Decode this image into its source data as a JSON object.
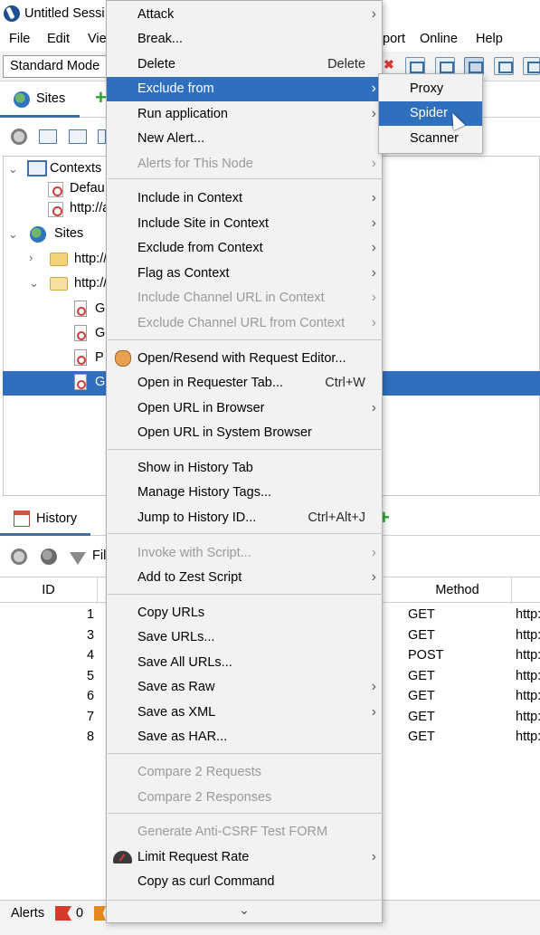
{
  "window": {
    "title": "Untitled Sessi"
  },
  "menubar": {
    "file": "File",
    "edit": "Edit",
    "view": "Vie",
    "report": "port",
    "online": "Online",
    "help": "Help"
  },
  "toolbar": {
    "mode": "Standard Mode"
  },
  "sites_panel": {
    "tab_label": "Sites",
    "tree": {
      "contexts": "Contexts",
      "default_context": "Defau",
      "context_url": "http://a",
      "sites": "Sites",
      "site1": "http://",
      "site2": "http://",
      "nodes": [
        "G",
        "G",
        "P",
        "G"
      ]
    }
  },
  "history_panel": {
    "tab_label": "History",
    "filter_label": "Fil",
    "columns": {
      "id": "ID",
      "method": "Method"
    },
    "rows": [
      {
        "id": "1",
        "method": "GET",
        "url": "http:"
      },
      {
        "id": "3",
        "method": "GET",
        "url": "http:"
      },
      {
        "id": "4",
        "method": "POST",
        "url": "http:"
      },
      {
        "id": "5",
        "method": "GET",
        "url": "http:"
      },
      {
        "id": "6",
        "method": "GET",
        "url": "http:"
      },
      {
        "id": "7",
        "method": "GET",
        "url": "http:"
      },
      {
        "id": "8",
        "method": "GET",
        "url": "http:"
      }
    ]
  },
  "statusbar": {
    "alerts_label": "Alerts",
    "alerts_count": "0"
  },
  "context_menu": {
    "items": [
      {
        "label": "Attack",
        "submenu": true
      },
      {
        "label": "Break..."
      },
      {
        "label": "Delete",
        "shortcut": "Delete"
      },
      {
        "label": "Exclude from",
        "submenu": true,
        "highlight": true
      },
      {
        "label": "Run application",
        "submenu": true
      },
      {
        "label": "New Alert..."
      },
      {
        "label": "Alerts for This Node",
        "submenu": true,
        "disabled": true
      },
      {
        "label": "Include in Context",
        "submenu": true
      },
      {
        "label": "Include Site in Context",
        "submenu": true
      },
      {
        "label": "Exclude from Context",
        "submenu": true
      },
      {
        "label": "Flag as Context",
        "submenu": true
      },
      {
        "label": "Include Channel URL in Context",
        "submenu": true,
        "disabled": true
      },
      {
        "label": "Exclude Channel URL from Context",
        "submenu": true,
        "disabled": true
      },
      {
        "label": "Open/Resend with Request Editor...",
        "icon": "hand-icon"
      },
      {
        "label": "Open in Requester Tab...",
        "shortcut": "Ctrl+W"
      },
      {
        "label": "Open URL in Browser",
        "submenu": true
      },
      {
        "label": "Open URL in System Browser"
      },
      {
        "label": "Show in History Tab"
      },
      {
        "label": "Manage History Tags..."
      },
      {
        "label": "Jump to History ID...",
        "shortcut": "Ctrl+Alt+J"
      },
      {
        "label": "Invoke with Script...",
        "submenu": true,
        "disabled": true
      },
      {
        "label": "Add to Zest Script",
        "submenu": true
      },
      {
        "label": "Copy URLs"
      },
      {
        "label": "Save URLs..."
      },
      {
        "label": "Save All URLs..."
      },
      {
        "label": "Save as Raw",
        "submenu": true
      },
      {
        "label": "Save as XML",
        "submenu": true
      },
      {
        "label": "Save as HAR..."
      },
      {
        "label": "Compare 2 Requests",
        "disabled": true
      },
      {
        "label": "Compare 2 Responses",
        "disabled": true
      },
      {
        "label": "Generate Anti-CSRF Test FORM",
        "disabled": true
      },
      {
        "label": "Limit Request Rate",
        "submenu": true,
        "icon": "meter-icon"
      },
      {
        "label": "Copy as curl Command"
      }
    ]
  },
  "submenu": {
    "items": [
      {
        "label": "Proxy"
      },
      {
        "label": "Spider",
        "highlight": true
      },
      {
        "label": "Scanner"
      }
    ]
  },
  "colors": {
    "highlight": "#2f6fbd",
    "menu_bg": "#f2f2f2",
    "disabled_text": "#9a9a9a"
  }
}
